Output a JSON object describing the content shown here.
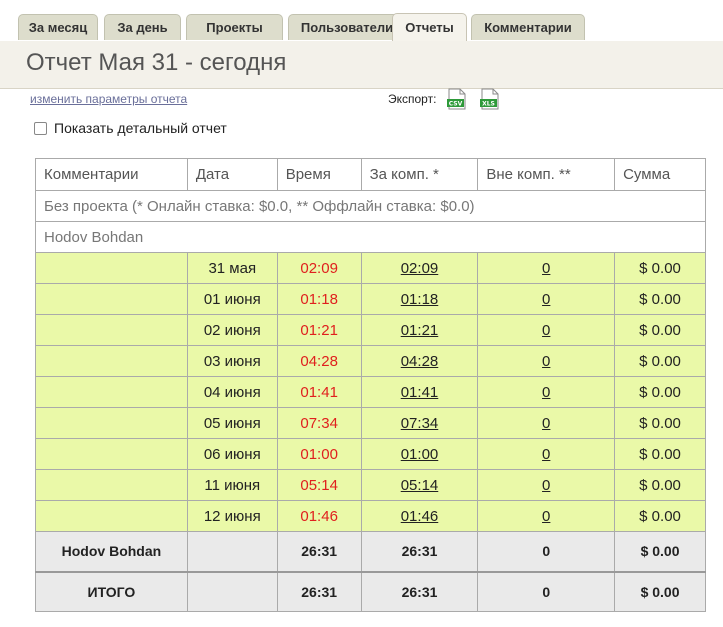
{
  "tabs": [
    {
      "label": "За месяц",
      "active": false
    },
    {
      "label": "За день",
      "active": false
    },
    {
      "label": "Проекты",
      "active": false
    },
    {
      "label": "Пользователи",
      "active": false
    },
    {
      "label": "Отчеты",
      "active": true
    },
    {
      "label": "Комментарии",
      "active": false
    }
  ],
  "header": {
    "title": "Отчет Мая 31 - сегодня"
  },
  "params": {
    "change_link": "изменить параметры отчета",
    "export_label": "Экспорт:",
    "export_icons": [
      {
        "name": "csv-export-icon",
        "text": "CSV"
      },
      {
        "name": "xls-export-icon",
        "text": "XLS"
      }
    ]
  },
  "detail": {
    "label": "Показать детальный отчет",
    "checked": false
  },
  "table": {
    "columns": [
      "Комментарии",
      "Дата",
      "Время",
      "За комп. *",
      "Вне комп. **",
      "Сумма"
    ],
    "project_row": "Без проекта (* Онлайн ставка: $0.0, ** Оффлайн ставка: $0.0)",
    "user_row": "Hodov Bohdan",
    "rows": [
      {
        "comment": "",
        "date": "31 мая",
        "time": "02:09",
        "in": "02:09",
        "out": "0",
        "sum": "$ 0.00"
      },
      {
        "comment": "",
        "date": "01 июня",
        "time": "01:18",
        "in": "01:18",
        "out": "0",
        "sum": "$ 0.00"
      },
      {
        "comment": "",
        "date": "02 июня",
        "time": "01:21",
        "in": "01:21",
        "out": "0",
        "sum": "$ 0.00"
      },
      {
        "comment": "",
        "date": "03 июня",
        "time": "04:28",
        "in": "04:28",
        "out": "0",
        "sum": "$ 0.00"
      },
      {
        "comment": "",
        "date": "04 июня",
        "time": "01:41",
        "in": "01:41",
        "out": "0",
        "sum": "$ 0.00"
      },
      {
        "comment": "",
        "date": "05 июня",
        "time": "07:34",
        "in": "07:34",
        "out": "0",
        "sum": "$ 0.00"
      },
      {
        "comment": "",
        "date": "06 июня",
        "time": "01:00",
        "in": "01:00",
        "out": "0",
        "sum": "$ 0.00"
      },
      {
        "comment": "",
        "date": "11 июня",
        "time": "05:14",
        "in": "05:14",
        "out": "0",
        "sum": "$ 0.00"
      },
      {
        "comment": "",
        "date": "12 июня",
        "time": "01:46",
        "in": "01:46",
        "out": "0",
        "sum": "$ 0.00"
      }
    ],
    "user_total": {
      "label": "Hodov Bohdan",
      "date": "",
      "time": "26:31",
      "in": "26:31",
      "out": "0",
      "sum": "$ 0.00"
    },
    "grand_total": {
      "label": "ИТОГО",
      "date": "",
      "time": "26:31",
      "in": "26:31",
      "out": "0",
      "sum": "$ 0.00"
    }
  },
  "colors": {
    "tab_bg": "#ddddcc",
    "header_bg": "#f3f1ea",
    "row_bg": "#eaf9a8",
    "total_bg": "#eaeaea",
    "time_red": "#e0201e",
    "link": "#6a6f9a"
  }
}
